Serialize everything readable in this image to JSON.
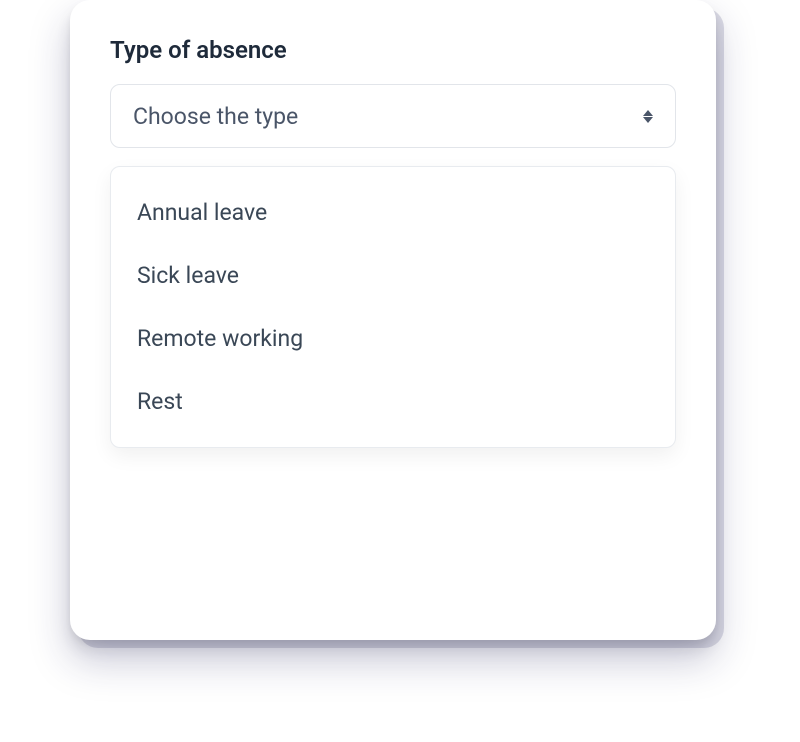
{
  "form": {
    "absence_type": {
      "label": "Type of absence",
      "placeholder": "Choose the type",
      "options": [
        {
          "label": "Annual leave"
        },
        {
          "label": "Sick leave"
        },
        {
          "label": "Remote working"
        },
        {
          "label": "Rest"
        }
      ]
    }
  }
}
